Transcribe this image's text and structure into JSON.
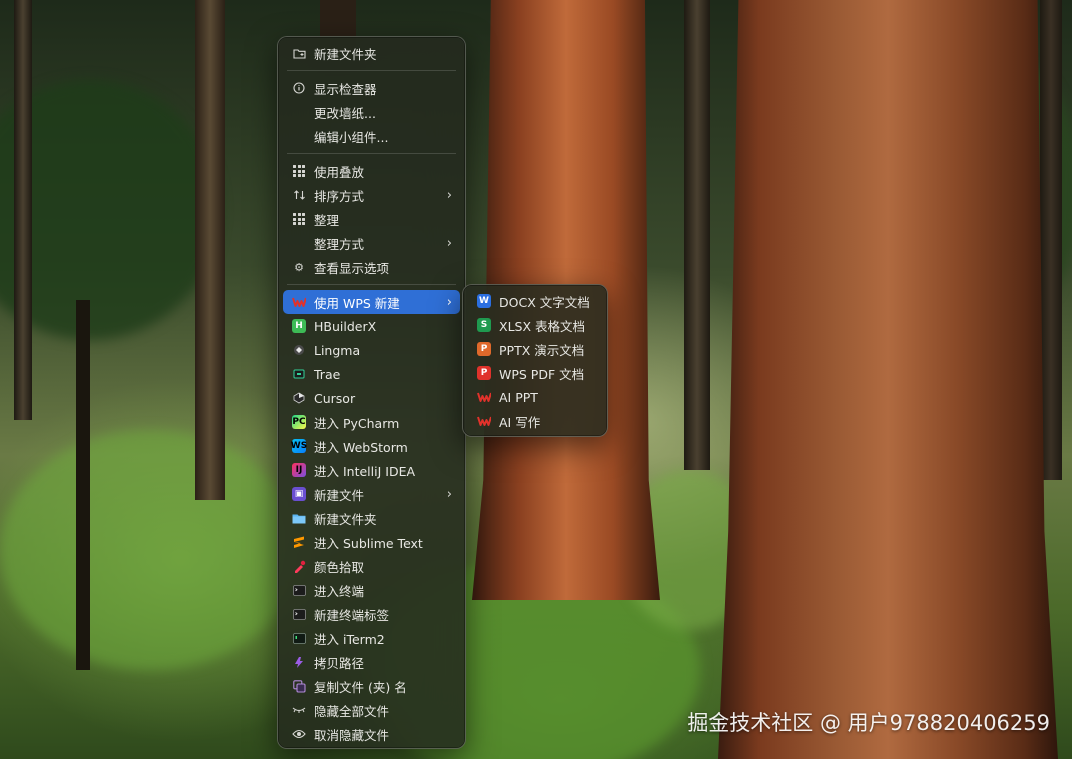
{
  "main_menu": {
    "group1": [
      {
        "label": "新建文件夹",
        "icon": "folder-plus-icon"
      }
    ],
    "group2": [
      {
        "label": "显示检查器",
        "icon": "info-icon"
      },
      {
        "label": "更改墙纸...",
        "icon": null
      },
      {
        "label": "编辑小组件...",
        "icon": null
      }
    ],
    "group3": [
      {
        "label": "使用叠放",
        "icon": "stack-grid-icon"
      },
      {
        "label": "排序方式",
        "icon": "sort-arrows-icon",
        "submenu": true
      },
      {
        "label": "整理",
        "icon": "grid-icon"
      },
      {
        "label": "整理方式",
        "icon": null,
        "submenu": true
      },
      {
        "label": "查看显示选项",
        "icon": "gear-icon"
      }
    ],
    "group4": [
      {
        "label": "使用 WPS 新建",
        "icon": "wps-icon",
        "submenu": true,
        "highlighted": true
      },
      {
        "label": "HBuilderX",
        "icon": "hbuilderx-icon"
      },
      {
        "label": "Lingma",
        "icon": "lingma-icon"
      },
      {
        "label": "Trae",
        "icon": "trae-icon"
      },
      {
        "label": "Cursor",
        "icon": "cursor-app-icon"
      },
      {
        "label": "进入 PyCharm",
        "icon": "pycharm-icon"
      },
      {
        "label": "进入 WebStorm",
        "icon": "webstorm-icon"
      },
      {
        "label": "进入 IntelliJ IDEA",
        "icon": "intellij-icon"
      },
      {
        "label": "新建文件",
        "icon": "new-file-icon",
        "submenu": true
      },
      {
        "label": "新建文件夹",
        "icon": "folder-icon"
      },
      {
        "label": "进入 Sublime Text",
        "icon": "sublime-icon"
      },
      {
        "label": "颜色拾取",
        "icon": "color-picker-icon"
      },
      {
        "label": "进入终端",
        "icon": "terminal-icon"
      },
      {
        "label": "新建终端标签",
        "icon": "terminal-tab-icon"
      },
      {
        "label": "进入 iTerm2",
        "icon": "iterm2-icon"
      },
      {
        "label": "拷贝路径",
        "icon": "copy-path-icon"
      },
      {
        "label": "复制文件 (夹) 名",
        "icon": "copy-name-icon"
      },
      {
        "label": "隐藏全部文件",
        "icon": "hide-eye-icon"
      },
      {
        "label": "取消隐藏文件",
        "icon": "eye-icon"
      }
    ]
  },
  "sub_menu": {
    "items": [
      {
        "label": "DOCX 文字文档",
        "icon": "wps-docx-icon"
      },
      {
        "label": "XLSX 表格文档",
        "icon": "wps-xlsx-icon"
      },
      {
        "label": "PPTX 演示文档",
        "icon": "wps-pptx-icon"
      },
      {
        "label": "WPS PDF 文档",
        "icon": "wps-pdf-icon"
      },
      {
        "label": "AI PPT",
        "icon": "wps-ai-icon"
      },
      {
        "label": "AI 写作",
        "icon": "wps-ai-icon"
      }
    ]
  },
  "watermark": "掘金技术社区 @ 用户978820406259",
  "colors": {
    "highlight": "#2f6fd6",
    "wps_red": "#e0322b",
    "docx_blue": "#2b6fe0",
    "xlsx_green": "#1f9a4f",
    "pptx_orange": "#e0692b"
  }
}
